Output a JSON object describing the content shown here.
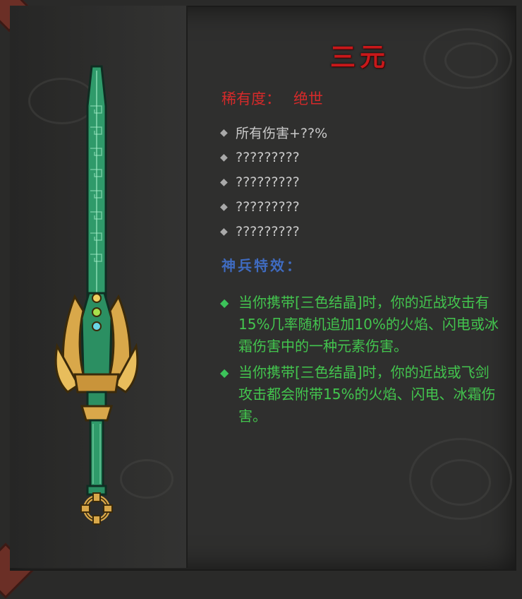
{
  "item": {
    "name": "三元",
    "rarity_label": "稀有度：",
    "rarity_value": "绝世"
  },
  "stats": [
    {
      "text": "所有伤害+??%"
    },
    {
      "text": "?????????"
    },
    {
      "text": "?????????"
    },
    {
      "text": "?????????"
    },
    {
      "text": "?????????"
    }
  ],
  "special_section": {
    "label": "神兵特效："
  },
  "effects": [
    {
      "text": "当你携带[三色结晶]时，你的近战攻击有15%几率随机追加10%的火焰、闪电或冰霜伤害中的一种元素伤害。"
    },
    {
      "text": "当你携带[三色结晶]时，你的近战或飞剑攻击都会附带15%的火焰、闪电、冰霜伤害。"
    }
  ],
  "colors": {
    "title": "#c8181a",
    "rarity": "#d52a2a",
    "stat_text": "#c9c9c9",
    "section": "#3f6bc0",
    "effect_text": "#43c54e",
    "blade": "#2f9a6a",
    "gold": "#d9a84a"
  },
  "icons": {
    "stat_bullet": "diamond-icon",
    "effect_bullet": "green-diamond-icon",
    "item_image": "jade-sword-icon"
  }
}
